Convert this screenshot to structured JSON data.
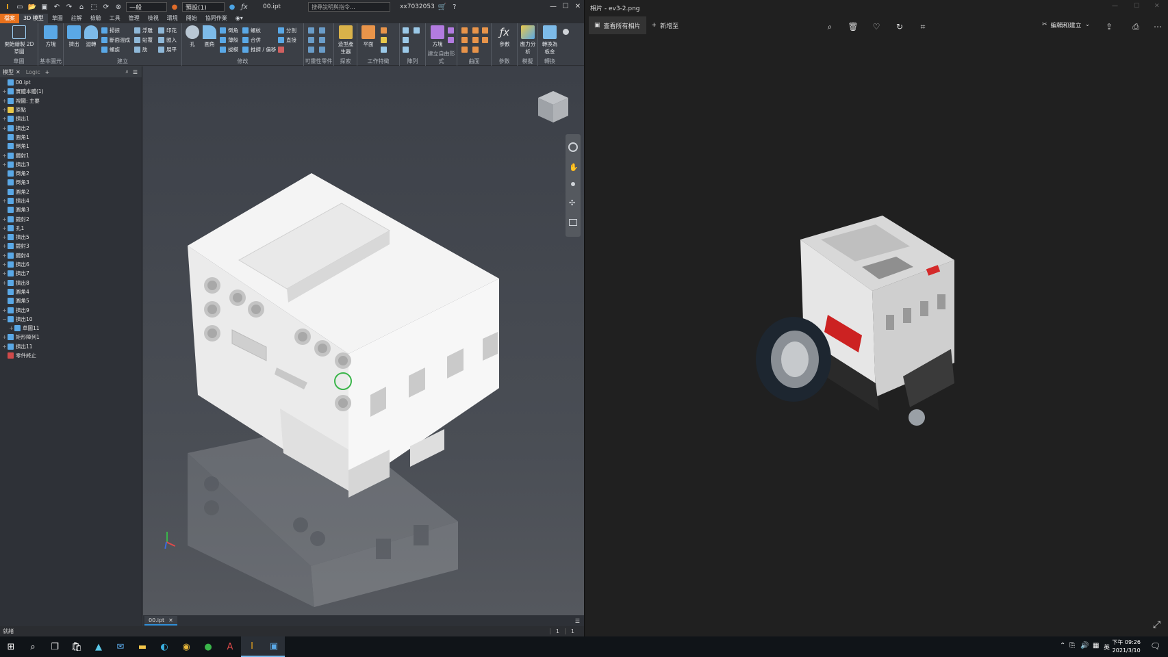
{
  "inventor": {
    "qa_dropdown_1": "一般",
    "qa_dropdown_2": "預設(1)",
    "filename": "00.ipt",
    "search_placeholder": "搜尋說明與指令...",
    "user": "xx7032053",
    "tabs": [
      "檔案",
      "3D 模型",
      "草圖",
      "註解",
      "檢驗",
      "工具",
      "管理",
      "檢視",
      "環境",
      "開始",
      "協同作業"
    ],
    "ribbon_groups": {
      "sketch": {
        "label": "草圖",
        "button": "開始繪製 2D 草圖"
      },
      "primitives": {
        "label": "基本圖元",
        "button": "方塊"
      },
      "create": {
        "label": "建立",
        "big": [
          "擠出",
          "迴轉"
        ],
        "small": [
          "掃掠",
          "斷面混成",
          "螺旋",
          "浮雕",
          "貼覆",
          "肋",
          "印花",
          "匯入",
          "展平"
        ]
      },
      "modify": {
        "label": "修改",
        "big": [
          "孔",
          "圓角"
        ],
        "small": [
          "倒角",
          "薄殼",
          "拔模",
          "螺紋",
          "合併",
          "推擠 / 偏移",
          "分割",
          "直接"
        ]
      },
      "fusion": {
        "label": "可靈性零件"
      },
      "explore": {
        "label": "探索",
        "button": "造型產生器"
      },
      "workfeatures": {
        "label": "工作特徵",
        "button": "平面"
      },
      "pattern": {
        "label": "陣列"
      },
      "freeform": {
        "label": "建立自由形式",
        "button": "方塊"
      },
      "surface": {
        "label": "曲面"
      },
      "params": {
        "label": "參數",
        "button": "參數"
      },
      "simulation": {
        "label": "模擬",
        "button": "應力分析"
      },
      "convert": {
        "label": "轉換",
        "button": "轉換為板金"
      }
    },
    "browser": {
      "tab_model": "模型",
      "tab_logic": "Logic",
      "tree": [
        {
          "exp": "",
          "label": "00.ipt"
        },
        {
          "exp": "+",
          "label": "實體本體(1)"
        },
        {
          "exp": "+",
          "label": "視圖: 主要"
        },
        {
          "exp": "+",
          "label": "原點"
        },
        {
          "exp": "+",
          "label": "擠出1"
        },
        {
          "exp": "+",
          "label": "擠出2"
        },
        {
          "exp": "",
          "label": "圓角1"
        },
        {
          "exp": "",
          "label": "倒角1"
        },
        {
          "exp": "+",
          "label": "鏡射1"
        },
        {
          "exp": "+",
          "label": "擠出3"
        },
        {
          "exp": "",
          "label": "倒角2"
        },
        {
          "exp": "",
          "label": "倒角3"
        },
        {
          "exp": "",
          "label": "圓角2"
        },
        {
          "exp": "+",
          "label": "擠出4"
        },
        {
          "exp": "",
          "label": "圓角3"
        },
        {
          "exp": "+",
          "label": "鏡射2"
        },
        {
          "exp": "+",
          "label": "孔1"
        },
        {
          "exp": "+",
          "label": "擠出5"
        },
        {
          "exp": "+",
          "label": "鏡射3"
        },
        {
          "exp": "+",
          "label": "鏡射4"
        },
        {
          "exp": "+",
          "label": "擠出6"
        },
        {
          "exp": "+",
          "label": "擠出7"
        },
        {
          "exp": "+",
          "label": "擠出8"
        },
        {
          "exp": "",
          "label": "圓角4"
        },
        {
          "exp": "",
          "label": "圓角5"
        },
        {
          "exp": "+",
          "label": "擠出9"
        },
        {
          "exp": "−",
          "label": "擠出10"
        },
        {
          "exp": "+",
          "label": "草圖11"
        },
        {
          "exp": "+",
          "label": "矩形陣列1"
        },
        {
          "exp": "+",
          "label": "擠出11"
        },
        {
          "exp": "",
          "label": "零件終止"
        }
      ]
    },
    "doc_tab": "00.ipt",
    "status_text": "就緒",
    "status_num_1": "1",
    "status_num_2": "1"
  },
  "photos": {
    "title": "相片 - ev3-2.png",
    "view_all": "查看所有相片",
    "add_to": "新增至",
    "edit_create": "編輯和建立"
  },
  "taskbar": {
    "time": "下午 09:26",
    "date": "2021/3/10",
    "lang": "英"
  },
  "colors": {
    "accent_orange": "#e8711c",
    "ui_dark": "#3b3f46",
    "photos_bg": "#202020"
  }
}
